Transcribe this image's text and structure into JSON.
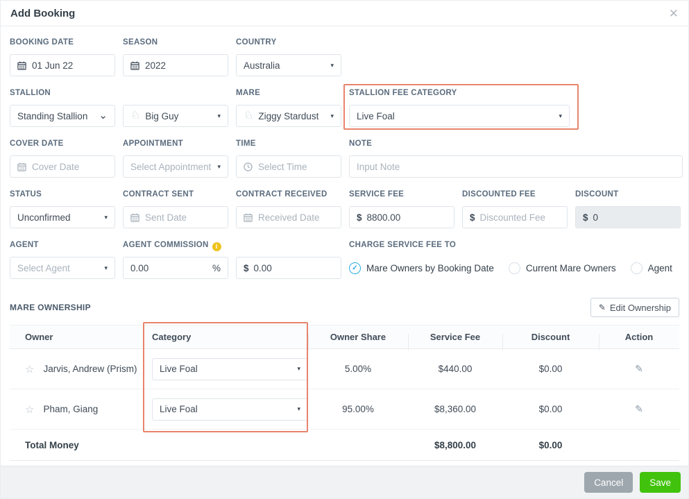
{
  "modal": {
    "title": "Add Booking"
  },
  "icons": {
    "close": "✕",
    "star": "☆",
    "horse": "♘",
    "pencil": "✎",
    "check": "✓",
    "caret": "▾",
    "chevron": "⌄",
    "info": "i"
  },
  "fields": {
    "booking_date": {
      "label": "BOOKING DATE",
      "value": "01 Jun 22"
    },
    "season": {
      "label": "SEASON",
      "value": "2022"
    },
    "country": {
      "label": "COUNTRY",
      "value": "Australia"
    },
    "stallion": {
      "label": "STALLION",
      "value": "Standing Stallion"
    },
    "stallion_name": {
      "value": "Big Guy"
    },
    "mare": {
      "label": "MARE",
      "value": "Ziggy Stardust"
    },
    "stallion_fee_category": {
      "label": "STALLION FEE CATEGORY",
      "value": "Live Foal"
    },
    "cover_date": {
      "label": "COVER DATE",
      "placeholder": "Cover Date"
    },
    "appointment": {
      "label": "APPOINTMENT",
      "placeholder": "Select Appointment"
    },
    "time": {
      "label": "TIME",
      "placeholder": "Select Time"
    },
    "note": {
      "label": "NOTE",
      "placeholder": "Input Note"
    },
    "status": {
      "label": "STATUS",
      "value": "Unconfirmed"
    },
    "contract_sent": {
      "label": "CONTRACT SENT",
      "placeholder": "Sent Date"
    },
    "contract_received": {
      "label": "CONTRACT RECEIVED",
      "placeholder": "Received Date"
    },
    "service_fee": {
      "label": "SERVICE FEE",
      "prefix": "$",
      "value": "8800.00"
    },
    "discounted_fee": {
      "label": "DISCOUNTED FEE",
      "prefix": "$",
      "placeholder": "Discounted Fee"
    },
    "discount": {
      "label": "DISCOUNT",
      "prefix": "$",
      "value": "0"
    },
    "agent": {
      "label": "AGENT",
      "placeholder": "Select Agent"
    },
    "agent_commission": {
      "label": "AGENT COMMISSION",
      "percent_value": "0.00",
      "percent_suffix": "%",
      "amount_prefix": "$",
      "amount_value": "0.00"
    },
    "charge_service_fee_to": {
      "label": "CHARGE SERVICE FEE TO",
      "options": [
        {
          "label": "Mare Owners by Booking Date",
          "selected": true
        },
        {
          "label": "Current Mare Owners",
          "selected": false
        },
        {
          "label": "Agent",
          "selected": false
        }
      ]
    }
  },
  "ownership": {
    "title": "MARE OWNERSHIP",
    "edit_button": "Edit Ownership",
    "columns": {
      "owner": "Owner",
      "category": "Category",
      "share": "Owner Share",
      "service_fee": "Service Fee",
      "discount": "Discount",
      "action": "Action"
    },
    "rows": [
      {
        "owner": "Jarvis, Andrew (Prism)",
        "category": "Live Foal",
        "share": "5.00%",
        "service_fee": "$440.00",
        "discount": "$0.00"
      },
      {
        "owner": "Pham, Giang",
        "category": "Live Foal",
        "share": "95.00%",
        "service_fee": "$8,360.00",
        "discount": "$0.00"
      }
    ],
    "total": {
      "label": "Total Money",
      "service_fee": "$8,800.00",
      "discount": "$0.00"
    }
  },
  "footer": {
    "cancel": "Cancel",
    "save": "Save"
  },
  "colors": {
    "highlight": "#e8836b",
    "save_green": "#41c30d",
    "cancel_gray": "#9ea7ae",
    "radio_blue": "#29abe2",
    "info_yellow": "#eec31e"
  }
}
